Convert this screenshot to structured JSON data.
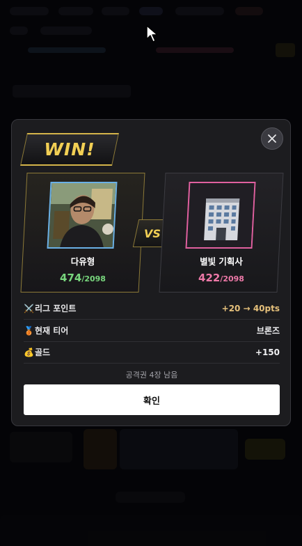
{
  "modal": {
    "badge": "WIN!",
    "vs_label": "VS",
    "player": {
      "name": "다유형",
      "score": "474",
      "score_max": "/2098",
      "avatar": "person-photo"
    },
    "opponent": {
      "name": "별빛 기획사",
      "score": "422",
      "score_max": "/2098",
      "avatar": "office-building-icon"
    },
    "rows": [
      {
        "icon": "⚔️",
        "icon_name": "swords-icon",
        "label": "리그 포인트",
        "value": "+20 → 40pts"
      },
      {
        "icon": "🥉",
        "icon_name": "bronze-medal-icon",
        "label": "현재 티어",
        "value": "브론즈"
      },
      {
        "icon": "💰",
        "icon_name": "money-bag-icon",
        "label": "골드",
        "value": "+150"
      }
    ],
    "tickets_text": "공격권 4장 남음",
    "confirm_label": "확인"
  },
  "colors": {
    "accent_gold": "#f2cf54",
    "player_green": "#78d67d",
    "opponent_pink": "#ee79a8"
  }
}
